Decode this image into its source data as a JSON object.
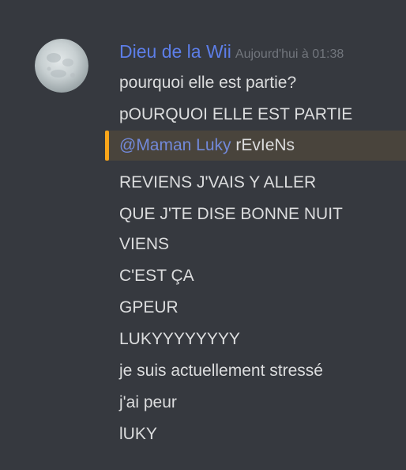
{
  "author": {
    "name": "Dieu de la Wii",
    "timestamp": "Aujourd'hui à 01:38",
    "avatar_icon": "full-moon-avatar"
  },
  "messages": [
    "pourquoi elle est partie?",
    "pOURQUOI ELLE EST PARTIE"
  ],
  "mention_message": {
    "mention": "@Maman Luky",
    "text": " rEvIeNs"
  },
  "messages_after": [
    "REVIENS J'VAIS Y ALLER",
    "QUE J'TE DISE BONNE NUIT",
    "VIENS",
    "C'EST ÇA",
    "GPEUR",
    "LUKYYYYYYYY",
    "je suis actuellement stressé",
    "j'ai peur",
    "lUKY"
  ],
  "colors": {
    "background": "#36393f",
    "username": "#5d7ee8",
    "timestamp": "#72767d",
    "text": "#dcddde",
    "mention": "#7289da",
    "mention_highlight": "#49443c",
    "mention_bar": "#faa61a"
  }
}
